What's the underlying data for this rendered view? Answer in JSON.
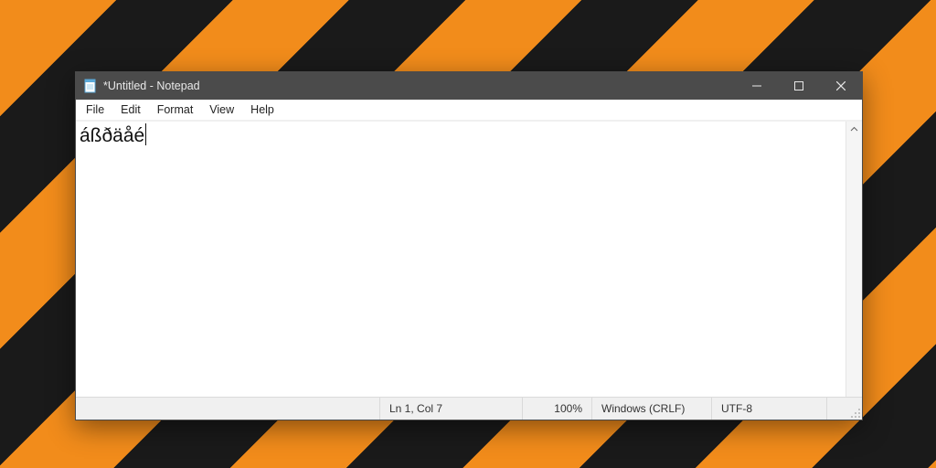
{
  "window": {
    "title": "*Untitled - Notepad"
  },
  "menu": {
    "file": "File",
    "edit": "Edit",
    "format": "Format",
    "view": "View",
    "help": "Help"
  },
  "editor": {
    "content": "áßðäåé"
  },
  "status": {
    "position": "Ln 1, Col 7",
    "zoom": "100%",
    "eol": "Windows (CRLF)",
    "encoding": "UTF-8"
  }
}
